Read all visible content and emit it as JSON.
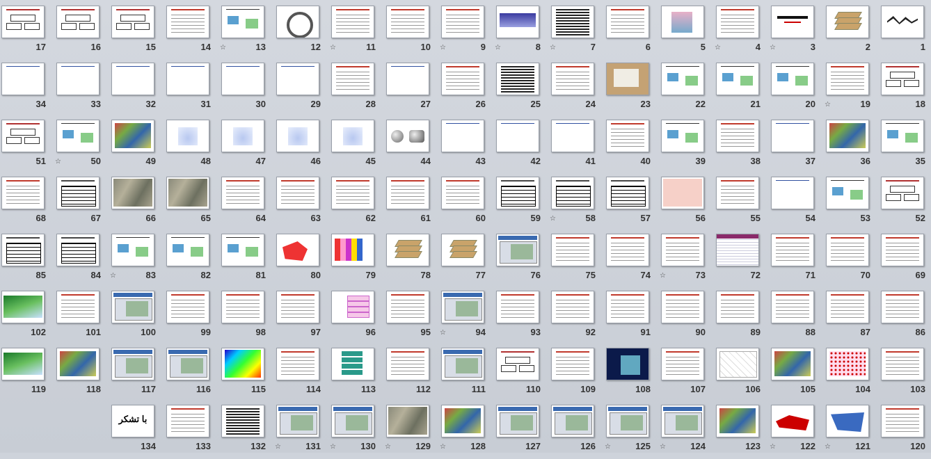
{
  "window": {
    "view": "slide-sorter"
  },
  "slides": [
    {
      "number": "1",
      "star": false,
      "thumb": "calligraphy"
    },
    {
      "number": "2",
      "star": false,
      "thumb": "layers"
    },
    {
      "number": "3",
      "star": true,
      "thumb": "title"
    },
    {
      "number": "4",
      "star": true,
      "thumb": "text"
    },
    {
      "number": "5",
      "star": false,
      "thumb": "picture"
    },
    {
      "number": "6",
      "star": false,
      "thumb": "text"
    },
    {
      "number": "7",
      "star": true,
      "thumb": "dense"
    },
    {
      "number": "8",
      "star": true,
      "thumb": "blue-banner"
    },
    {
      "number": "9",
      "star": true,
      "thumb": "text"
    },
    {
      "number": "10",
      "star": false,
      "thumb": "text"
    },
    {
      "number": "11",
      "star": true,
      "thumb": "text"
    },
    {
      "number": "12",
      "star": false,
      "thumb": "cycle"
    },
    {
      "number": "13",
      "star": true,
      "thumb": "diagram"
    },
    {
      "number": "14",
      "star": false,
      "thumb": "text"
    },
    {
      "number": "15",
      "star": false,
      "thumb": "boxes"
    },
    {
      "number": "16",
      "star": false,
      "thumb": "boxes"
    },
    {
      "number": "17",
      "star": false,
      "thumb": "boxes"
    },
    {
      "number": "18",
      "star": false,
      "thumb": "boxes"
    },
    {
      "number": "19",
      "star": true,
      "thumb": "text"
    },
    {
      "number": "20",
      "star": false,
      "thumb": "diagram"
    },
    {
      "number": "21",
      "star": false,
      "thumb": "diagram"
    },
    {
      "number": "22",
      "star": false,
      "thumb": "diagram"
    },
    {
      "number": "23",
      "star": false,
      "thumb": "photo"
    },
    {
      "number": "24",
      "star": false,
      "thumb": "text"
    },
    {
      "number": "25",
      "star": false,
      "thumb": "dense"
    },
    {
      "number": "26",
      "star": false,
      "thumb": "text"
    },
    {
      "number": "27",
      "star": false,
      "thumb": "globe"
    },
    {
      "number": "28",
      "star": false,
      "thumb": "text"
    },
    {
      "number": "29",
      "star": false,
      "thumb": "globe"
    },
    {
      "number": "30",
      "star": false,
      "thumb": "globe"
    },
    {
      "number": "31",
      "star": false,
      "thumb": "globe"
    },
    {
      "number": "32",
      "star": false,
      "thumb": "globe"
    },
    {
      "number": "33",
      "star": false,
      "thumb": "globe"
    },
    {
      "number": "34",
      "star": false,
      "thumb": "globe"
    },
    {
      "number": "35",
      "star": false,
      "thumb": "diagram"
    },
    {
      "number": "36",
      "star": false,
      "thumb": "map"
    },
    {
      "number": "37",
      "star": false,
      "thumb": "globe"
    },
    {
      "number": "38",
      "star": false,
      "thumb": "text"
    },
    {
      "number": "39",
      "star": false,
      "thumb": "diagram"
    },
    {
      "number": "40",
      "star": false,
      "thumb": "text"
    },
    {
      "number": "41",
      "star": false,
      "thumb": "globe"
    },
    {
      "number": "42",
      "star": false,
      "thumb": "globe"
    },
    {
      "number": "43",
      "star": false,
      "thumb": "globe"
    },
    {
      "number": "44",
      "star": false,
      "thumb": "sphere"
    },
    {
      "number": "45",
      "star": false,
      "thumb": "projection"
    },
    {
      "number": "46",
      "star": false,
      "thumb": "projection"
    },
    {
      "number": "47",
      "star": false,
      "thumb": "projection"
    },
    {
      "number": "48",
      "star": false,
      "thumb": "projection"
    },
    {
      "number": "49",
      "star": false,
      "thumb": "map"
    },
    {
      "number": "50",
      "star": true,
      "thumb": "diagram"
    },
    {
      "number": "51",
      "star": false,
      "thumb": "boxes"
    },
    {
      "number": "52",
      "star": false,
      "thumb": "boxes"
    },
    {
      "number": "53",
      "star": false,
      "thumb": "diagram"
    },
    {
      "number": "54",
      "star": false,
      "thumb": "globe"
    },
    {
      "number": "55",
      "star": false,
      "thumb": "text"
    },
    {
      "number": "56",
      "star": false,
      "thumb": "worldmap"
    },
    {
      "number": "57",
      "star": false,
      "thumb": "table"
    },
    {
      "number": "58",
      "star": true,
      "thumb": "table"
    },
    {
      "number": "59",
      "star": false,
      "thumb": "table"
    },
    {
      "number": "60",
      "star": false,
      "thumb": "text"
    },
    {
      "number": "61",
      "star": false,
      "thumb": "text"
    },
    {
      "number": "62",
      "star": false,
      "thumb": "text"
    },
    {
      "number": "63",
      "star": false,
      "thumb": "text"
    },
    {
      "number": "64",
      "star": false,
      "thumb": "text"
    },
    {
      "number": "65",
      "star": false,
      "thumb": "aerial"
    },
    {
      "number": "66",
      "star": false,
      "thumb": "aerial"
    },
    {
      "number": "67",
      "star": false,
      "thumb": "table"
    },
    {
      "number": "68",
      "star": false,
      "thumb": "text"
    },
    {
      "number": "69",
      "star": false,
      "thumb": "text"
    },
    {
      "number": "70",
      "star": false,
      "thumb": "text"
    },
    {
      "number": "71",
      "star": false,
      "thumb": "text"
    },
    {
      "number": "72",
      "star": false,
      "thumb": "spreadsheet"
    },
    {
      "number": "73",
      "star": true,
      "thumb": "text"
    },
    {
      "number": "74",
      "star": false,
      "thumb": "text"
    },
    {
      "number": "75",
      "star": false,
      "thumb": "text"
    },
    {
      "number": "76",
      "star": false,
      "thumb": "screenshot"
    },
    {
      "number": "77",
      "star": false,
      "thumb": "layers"
    },
    {
      "number": "78",
      "star": false,
      "thumb": "layers"
    },
    {
      "number": "79",
      "star": false,
      "thumb": "grid"
    },
    {
      "number": "80",
      "star": false,
      "thumb": "polygon"
    },
    {
      "number": "81",
      "star": false,
      "thumb": "diagram"
    },
    {
      "number": "82",
      "star": false,
      "thumb": "diagram"
    },
    {
      "number": "83",
      "star": true,
      "thumb": "diagram"
    },
    {
      "number": "84",
      "star": false,
      "thumb": "table"
    },
    {
      "number": "85",
      "star": false,
      "thumb": "table"
    },
    {
      "number": "86",
      "star": false,
      "thumb": "text"
    },
    {
      "number": "87",
      "star": false,
      "thumb": "text"
    },
    {
      "number": "88",
      "star": false,
      "thumb": "text"
    },
    {
      "number": "89",
      "star": false,
      "thumb": "text"
    },
    {
      "number": "90",
      "star": false,
      "thumb": "text"
    },
    {
      "number": "91",
      "star": false,
      "thumb": "text"
    },
    {
      "number": "92",
      "star": false,
      "thumb": "text"
    },
    {
      "number": "93",
      "star": false,
      "thumb": "text"
    },
    {
      "number": "94",
      "star": true,
      "thumb": "screenshot"
    },
    {
      "number": "95",
      "star": false,
      "thumb": "text"
    },
    {
      "number": "96",
      "star": false,
      "thumb": "pinkboxes"
    },
    {
      "number": "97",
      "star": false,
      "thumb": "text"
    },
    {
      "number": "98",
      "star": false,
      "thumb": "text"
    },
    {
      "number": "99",
      "star": false,
      "thumb": "text"
    },
    {
      "number": "100",
      "star": false,
      "thumb": "screenshot"
    },
    {
      "number": "101",
      "star": false,
      "thumb": "text"
    },
    {
      "number": "102",
      "star": false,
      "thumb": "terrain"
    },
    {
      "number": "103",
      "star": false,
      "thumb": "text"
    },
    {
      "number": "104",
      "star": false,
      "thumb": "dotmap"
    },
    {
      "number": "105",
      "star": false,
      "thumb": "map"
    },
    {
      "number": "106",
      "star": false,
      "thumb": "linemap"
    },
    {
      "number": "107",
      "star": false,
      "thumb": "text"
    },
    {
      "number": "108",
      "star": false,
      "thumb": "darkslide"
    },
    {
      "number": "109",
      "star": false,
      "thumb": "text"
    },
    {
      "number": "110",
      "star": false,
      "thumb": "boxes"
    },
    {
      "number": "111",
      "star": false,
      "thumb": "screenshot"
    },
    {
      "number": "112",
      "star": false,
      "thumb": "text"
    },
    {
      "number": "113",
      "star": false,
      "thumb": "tealboxes"
    },
    {
      "number": "114",
      "star": false,
      "thumb": "text"
    },
    {
      "number": "115",
      "star": false,
      "thumb": "heat"
    },
    {
      "number": "116",
      "star": false,
      "thumb": "screenshot"
    },
    {
      "number": "117",
      "star": false,
      "thumb": "screenshot"
    },
    {
      "number": "118",
      "star": false,
      "thumb": "map"
    },
    {
      "number": "119",
      "star": false,
      "thumb": "terrain"
    },
    {
      "number": "120",
      "star": false,
      "thumb": "text"
    },
    {
      "number": "121",
      "star": true,
      "thumb": "usmap"
    },
    {
      "number": "122",
      "star": true,
      "thumb": "redmap"
    },
    {
      "number": "123",
      "star": false,
      "thumb": "map"
    },
    {
      "number": "124",
      "star": true,
      "thumb": "screenshot"
    },
    {
      "number": "125",
      "star": true,
      "thumb": "screenshot"
    },
    {
      "number": "126",
      "star": false,
      "thumb": "screenshot"
    },
    {
      "number": "127",
      "star": false,
      "thumb": "screenshot"
    },
    {
      "number": "128",
      "star": true,
      "thumb": "map"
    },
    {
      "number": "129",
      "star": true,
      "thumb": "aerial"
    },
    {
      "number": "130",
      "star": true,
      "thumb": "screenshot"
    },
    {
      "number": "131",
      "star": true,
      "thumb": "screenshot"
    },
    {
      "number": "132",
      "star": false,
      "thumb": "dense"
    },
    {
      "number": "133",
      "star": false,
      "thumb": "text"
    },
    {
      "number": "134",
      "star": false,
      "thumb": "thanks",
      "text": "با تشکر"
    }
  ],
  "colors": {
    "background": "#ced3db",
    "number": "#333333",
    "thumb_border": "#9aa0aa"
  },
  "icons": {
    "slide_transition": "star-icon"
  }
}
